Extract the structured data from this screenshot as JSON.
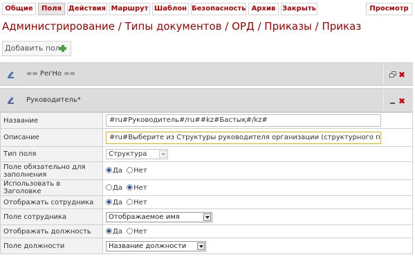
{
  "tabs": [
    {
      "label": "Общие",
      "active": false
    },
    {
      "label": "Поля",
      "active": true
    },
    {
      "label": "Действия",
      "active": false
    },
    {
      "label": "Маршрут",
      "active": false
    },
    {
      "label": "Шаблон",
      "active": false
    },
    {
      "label": "Безопасность",
      "active": false
    },
    {
      "label": "Архив",
      "active": false
    },
    {
      "label": "Закрыть",
      "active": false
    }
  ],
  "preview_label": "Просмотр",
  "breadcrumb": "Администрирование / Типы документов / ОРД / Приказы / Приказ",
  "add_field_label": "Добавить поле",
  "sections": [
    {
      "title": "== РегНо ==",
      "state": "collapsed"
    },
    {
      "title": "Руководитель*",
      "state": "expanded"
    }
  ],
  "fields": {
    "name": {
      "label": "Название",
      "value": "#ru#Руководитель#/ru##kz#Бастық#/kz#"
    },
    "description": {
      "label": "Описание",
      "value": "#ru#Выберите из Структуры руководителя организации (структурного подразделения)#/ru#"
    },
    "field_type": {
      "label": "Тип поля",
      "value": "Структура"
    },
    "required": {
      "label": "Поле обязательно для заполнения",
      "selected": "Да"
    },
    "use_in_header": {
      "label": "Использовать в Заголовке",
      "selected": "Нет"
    },
    "show_employee": {
      "label": "Отображать сотрудника",
      "selected": "Да"
    },
    "employee_field": {
      "label": "Поле сотрудника",
      "value": "Отображаемое имя"
    },
    "show_position": {
      "label": "Отображать должность",
      "selected": "Да"
    },
    "position_field": {
      "label": "Поле должности",
      "value": "Название должности"
    }
  },
  "radio_options": {
    "yes": "Да",
    "no": "Нет"
  },
  "colors": {
    "accent": "#b00000",
    "section_bg": "#dcdcdc",
    "close": "#d40000",
    "add": "#3fa33f"
  }
}
